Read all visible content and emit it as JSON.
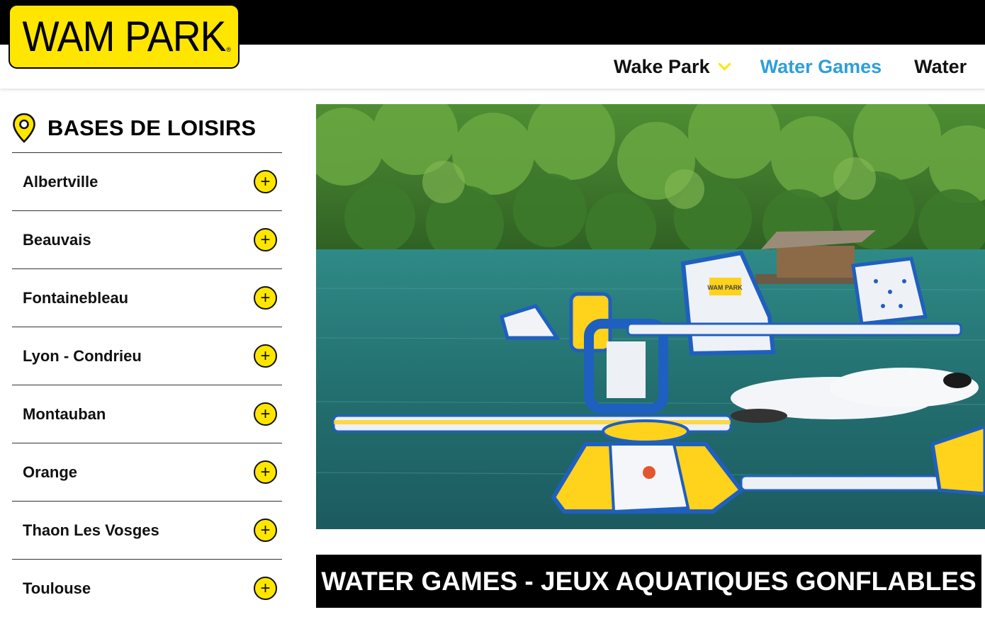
{
  "brand": {
    "logo_text": "WAM PARK",
    "registered_mark": "®",
    "accent_color": "#ffe600"
  },
  "nav": {
    "items": [
      {
        "label": "Wake Park",
        "has_dropdown": true,
        "active": false
      },
      {
        "label": "Water Games",
        "has_dropdown": false,
        "active": true
      },
      {
        "label": "Water",
        "has_dropdown": false,
        "active": false
      }
    ],
    "active_color": "#2e9fd8"
  },
  "sidebar": {
    "title": "BASES DE LOISIRS",
    "icon": "location-pin-icon",
    "items": [
      {
        "label": "Albertville",
        "icon": "plus-circle-icon"
      },
      {
        "label": "Beauvais",
        "icon": "plus-circle-icon"
      },
      {
        "label": "Fontainebleau",
        "icon": "plus-circle-icon"
      },
      {
        "label": "Lyon - Condrieu",
        "icon": "plus-circle-icon"
      },
      {
        "label": "Montauban",
        "icon": "plus-circle-icon"
      },
      {
        "label": "Orange",
        "icon": "plus-circle-icon"
      },
      {
        "label": "Thaon Les Vosges",
        "icon": "plus-circle-icon"
      },
      {
        "label": "Toulouse",
        "icon": "plus-circle-icon"
      }
    ]
  },
  "hero": {
    "image_label": "WAM PARK"
  },
  "main": {
    "title": "WATER GAMES - JEUX AQUATIQUES GONFLABLES"
  }
}
